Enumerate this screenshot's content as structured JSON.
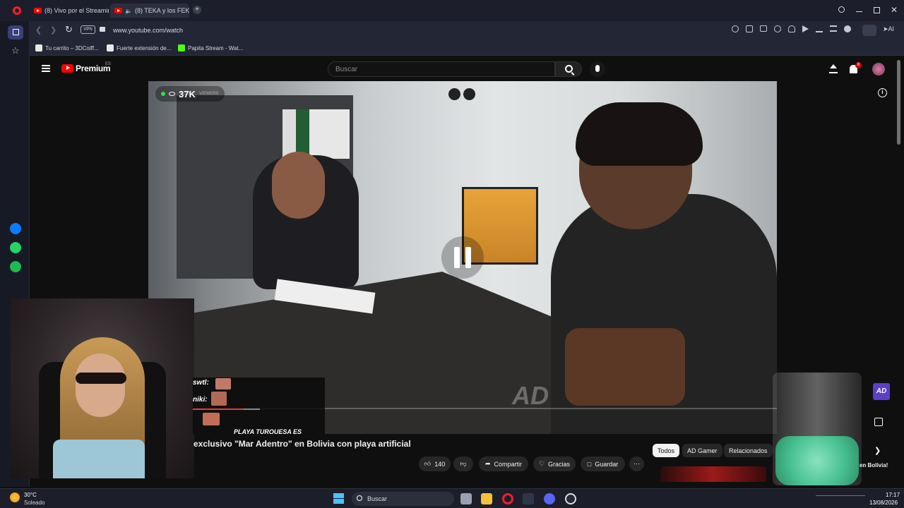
{
  "browser": {
    "tabs": [
      {
        "label": "(8) Vivo por el Streaming"
      },
      {
        "label": "(8) TEKA y los FEKAS …"
      }
    ],
    "address": "www.youtube.com/watch",
    "vpn_label": "VPN",
    "ai_label": "AI",
    "bookmarks": [
      {
        "label": "Tu carrito – 3DCoiff..."
      },
      {
        "label": "Fuerte extensión de..."
      },
      {
        "label": "Papita Stream - Wat..."
      }
    ]
  },
  "youtube": {
    "logo": "Premium",
    "region": "ES",
    "search_placeholder": "Buscar",
    "notification_count": "8",
    "viewers": "37K",
    "viewers_suffix": "VIEWERS",
    "video_title": "exclusivo \"Mar Adentro\" en Bolivia con playa artificial",
    "likes": "140",
    "share": "Compartir",
    "thanks": "Gracias",
    "save": "Guardar",
    "chips": [
      "Todos",
      "AD Gamer",
      "Relacionados"
    ],
    "side_snippet": "en Bolivia!",
    "watermark": "AD"
  },
  "chat": {
    "lines": [
      "swtl:",
      "niki:",
      "PLAYA TURQUESA ES"
    ]
  },
  "taskbar": {
    "weather_temp": "30°C",
    "weather_desc": "Soleado",
    "search": "Buscar",
    "time": "17:17",
    "date": "13/08/2026"
  },
  "colors": {
    "yt_red": "#ff0000",
    "chrome_bg": "#1c1f2b",
    "opera_red": "#ff1b2d",
    "messenger": "#0a7cff",
    "whatsapp": "#25d366",
    "spotify": "#1db954"
  }
}
